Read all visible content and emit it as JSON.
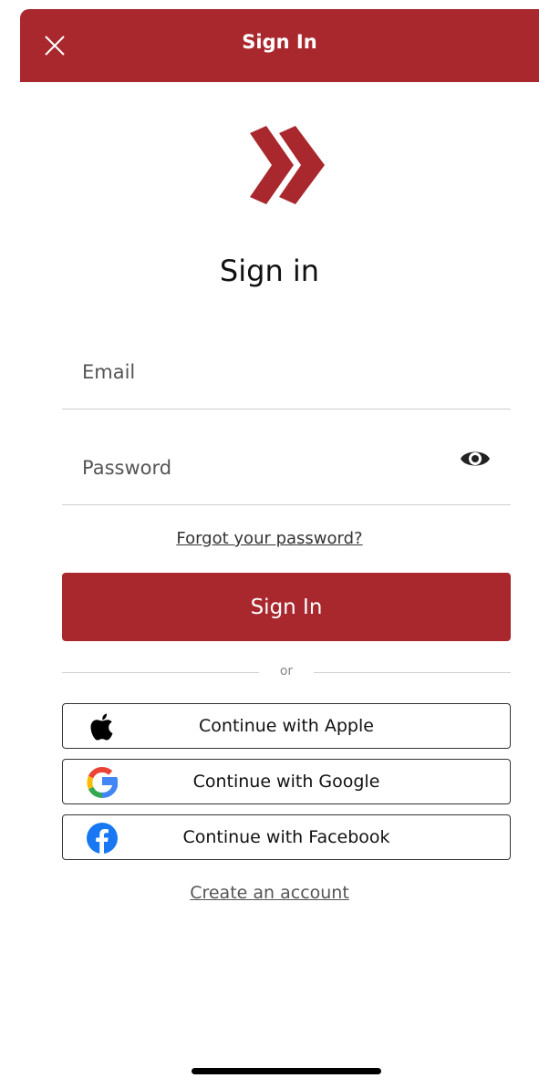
{
  "header": {
    "title": "Sign In",
    "close_icon": "close-icon",
    "background_color": "#a9282e"
  },
  "logo": {
    "icon": "double-chevron-right-logo",
    "color": "#a9282e"
  },
  "page_title": "Sign in",
  "form": {
    "email_placeholder": "Email",
    "email_value": "",
    "password_placeholder": "Password",
    "password_value": "",
    "password_toggle_icon": "eye-icon"
  },
  "forgot_password_label": "Forgot your password?",
  "sign_in_button_label": "Sign In",
  "divider_text": "or",
  "social": [
    {
      "label": "Continue with Apple",
      "icon": "apple-icon"
    },
    {
      "label": "Continue with Google",
      "icon": "google-icon"
    },
    {
      "label": "Continue with Facebook",
      "icon": "facebook-icon"
    }
  ],
  "create_account_label": "Create an account",
  "colors": {
    "brand": "#a9282e",
    "facebook": "#1877f2",
    "google_blue": "#4285f4",
    "google_red": "#ea4335",
    "google_yellow": "#fbbc05",
    "google_green": "#34a853"
  }
}
